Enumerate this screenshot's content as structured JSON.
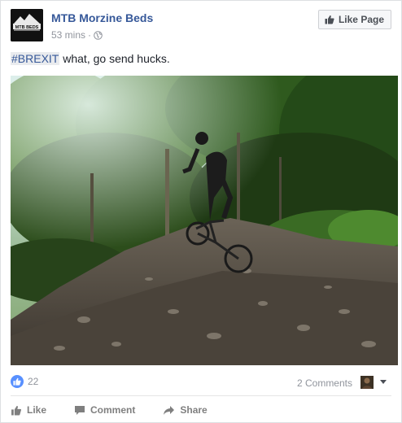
{
  "post": {
    "page_name": "MTB Morzine Beds",
    "time_ago": "53 mins",
    "separator": "·",
    "avatar_text": "MTB BEDS",
    "like_page_label": "Like Page",
    "hashtag": "#BREXIT",
    "text": " what, go send hucks.",
    "photo_icon": "mountain-bike-jump-photo"
  },
  "stats": {
    "likes": "22",
    "comments": "2 Comments"
  },
  "actions": {
    "like": "Like",
    "comment": "Comment",
    "share": "Share"
  },
  "colors": {
    "link": "#365899",
    "like_blue": "#5890ff",
    "muted": "#90949c"
  }
}
